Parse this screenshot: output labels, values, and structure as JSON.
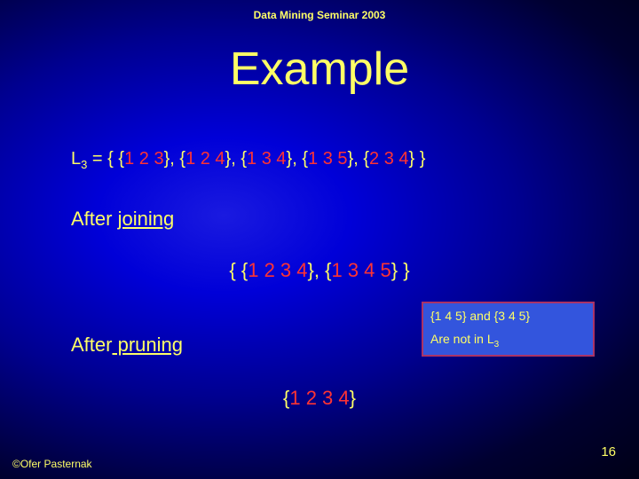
{
  "header": "Data Mining Seminar 2003",
  "title": "Example",
  "l3": {
    "prefix": "L",
    "sub": "3",
    "eq": " = { ",
    "sets": [
      {
        "open": "{",
        "vals": "1 2 3",
        "close": "}"
      },
      {
        "open": "{",
        "vals": "1 2 4",
        "close": "}"
      },
      {
        "open": "{",
        "vals": "1 3 4",
        "close": "}"
      },
      {
        "open": "{",
        "vals": "1 3 5",
        "close": "}"
      },
      {
        "open": "{",
        "vals": "2 3 4",
        "close": "}"
      }
    ],
    "end": " }"
  },
  "afterjoin": {
    "word1": "After ",
    "word2": "joining"
  },
  "joined": {
    "open": "{ ",
    "sets": [
      {
        "open": "{",
        "vals": "1 2 3 4",
        "close": "}"
      },
      {
        "open": "{",
        "vals": "1 3 4 5",
        "close": "}"
      }
    ],
    "end": " }"
  },
  "afterprune": {
    "word1": "After",
    "word2": " pruning"
  },
  "note": {
    "l1a": "{1 4 5} and {3 4 5}",
    "l2a": "Are not in L",
    "l2b": "3"
  },
  "pruned": {
    "open": "{",
    "vals": "1 2 3 4",
    "close": "}"
  },
  "footer": {
    "left": "©Ofer Pasternak",
    "right": "16"
  }
}
